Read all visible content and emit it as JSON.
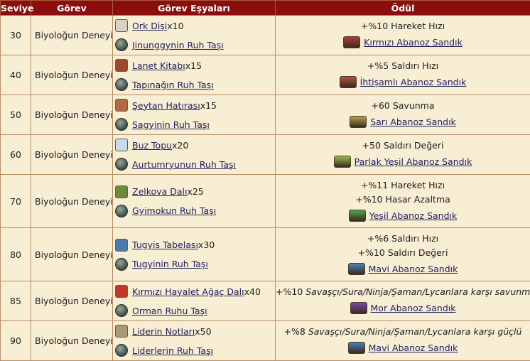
{
  "headers": {
    "level": "Seviye",
    "quest": "Görev",
    "items": "Görev Eşyaları",
    "reward": "Ödül"
  },
  "rows": [
    {
      "level": "30",
      "quest": "Biyoloğun Deneyi",
      "item_name": "Ork Dişi",
      "item_qty": " x10",
      "item_icon": "tooth-icon",
      "item_color": "#d8d2c4",
      "stone_name": "Jinunggynin Ruh Taşı",
      "stone_icon": "spirit-stone-icon",
      "bonus_prefix": "",
      "bonus_italic": "",
      "bonus_lines": [
        "+%10 Hareket Hızı"
      ],
      "chest_name": "Kırmızı Abanoz Sandık",
      "chest_color": "#b23a3a"
    },
    {
      "level": "40",
      "quest": "Biyoloğun Deneyi",
      "item_name": "Lanet Kitabı",
      "item_qty": " x15",
      "item_icon": "book-icon",
      "item_color": "#9a4a32",
      "stone_name": "Tapınağın Ruh Taşı",
      "stone_icon": "spirit-stone-icon",
      "bonus_prefix": "",
      "bonus_italic": "",
      "bonus_lines": [
        "+%5 Saldırı Hızı"
      ],
      "chest_name": "İhtişamlı Abanoz Sandık",
      "chest_color": "#b5533c"
    },
    {
      "level": "50",
      "quest": "Biyoloğun Deneyi",
      "item_name": "Şeytan Hatırası",
      "item_qty": " x15",
      "item_icon": "memento-icon",
      "item_color": "#b06a48",
      "stone_name": "Sagyinin Ruh Taşı",
      "stone_icon": "spirit-stone-icon",
      "bonus_prefix": "",
      "bonus_italic": "",
      "bonus_lines": [
        "+60 Savunma"
      ],
      "chest_name": "Sarı Abanoz Sandık",
      "chest_color": "#b8a24a"
    },
    {
      "level": "60",
      "quest": "Biyoloğun Deneyi",
      "item_name": "Buz Topu",
      "item_qty": " x20",
      "item_icon": "ice-ball-icon",
      "item_color": "#c9dbe8",
      "stone_name": "Aurtumryunun Ruh Taşı",
      "stone_icon": "spirit-stone-icon",
      "bonus_prefix": "",
      "bonus_italic": "",
      "bonus_lines": [
        "+50 Saldırı Değeri"
      ],
      "chest_name": "Parlak Yeşil Abanoz Sandık",
      "chest_color": "#9bb84a"
    },
    {
      "level": "70",
      "quest": "Biyoloğun Deneyi",
      "item_name": "Zelkova Dalı",
      "item_qty": " x25",
      "item_icon": "branch-icon",
      "item_color": "#6e8a3a",
      "stone_name": "Gyimokun Ruh Taşı",
      "stone_icon": "spirit-stone-icon",
      "bonus_prefix": "",
      "bonus_italic": "",
      "bonus_lines": [
        "+%11 Hareket Hızı",
        "+%10 Hasar Azaltma"
      ],
      "chest_name": "Yeşil Abanoz Sandık",
      "chest_color": "#4fa84a"
    },
    {
      "level": "80",
      "quest": "Biyoloğun Deneyi",
      "item_name": "Tugyis Tabelası",
      "item_qty": " x30",
      "item_icon": "tablet-icon",
      "item_color": "#4a7aa8",
      "stone_name": "Tugyinin Ruh Taşı",
      "stone_icon": "spirit-stone-icon",
      "bonus_prefix": "",
      "bonus_italic": "",
      "bonus_lines": [
        "+%6 Saldırı Hızı",
        "+%10 Saldırı Değeri"
      ],
      "chest_name": "Mavi Abanoz Sandık",
      "chest_color": "#4a82b8"
    },
    {
      "level": "85",
      "quest": "Biyoloğun Deneyi",
      "item_name": "Kırmızı Hayalet Ağaç Dalı",
      "item_qty": " x40",
      "item_icon": "red-branch-icon",
      "item_color": "#c03a2a",
      "stone_name": "Orman Ruhu Taşı",
      "stone_icon": "spirit-stone-icon",
      "bonus_prefix": "+%10 ",
      "bonus_italic": "Savaşçı/Sura/Ninja/Şaman/Lycanlara karşı savunma",
      "bonus_lines": [],
      "chest_name": "Mor Abanoz Sandık",
      "chest_color": "#7a4aa8"
    },
    {
      "level": "90",
      "quest": "Biyoloğun Deneyi",
      "item_name": "Liderin Notları",
      "item_qty": " x50",
      "item_icon": "notes-icon",
      "item_color": "#a89a72",
      "stone_name": "Liderlerin Ruh Taşı",
      "stone_icon": "spirit-stone-icon",
      "bonus_prefix": "+%8 ",
      "bonus_italic": "Savaşçı/Sura/Ninja/Şaman/Lycanlara karşı güçlü",
      "bonus_lines": [],
      "chest_name": "Mavi Abanoz Sandık",
      "chest_color": "#4a82b8"
    }
  ]
}
